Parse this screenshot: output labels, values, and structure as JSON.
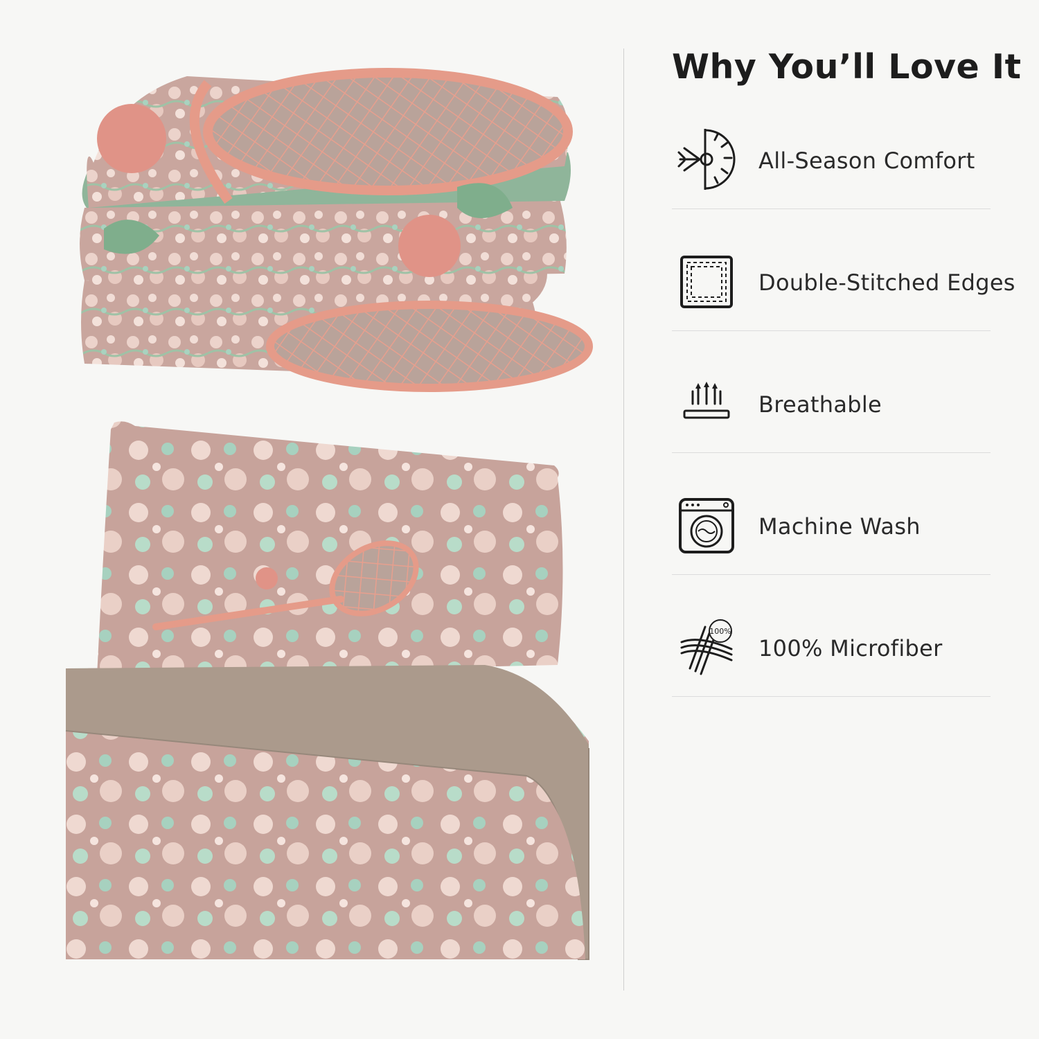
{
  "heading": "Why You’ll Love It",
  "features": [
    {
      "label": "All-Season Comfort",
      "icon": "sun-snowflake-icon"
    },
    {
      "label": "Double-Stitched Edges",
      "icon": "stitched-square-icon"
    },
    {
      "label": "Breathable",
      "icon": "breathable-arrows-icon"
    },
    {
      "label": "Machine Wash",
      "icon": "washing-machine-icon"
    },
    {
      "label": "100% Microfiber",
      "icon": "microfiber-fabric-icon"
    }
  ],
  "icon_badge_text": "100%",
  "colors": {
    "background": "#f7f7f5",
    "fabric_pink": "#d9a9a0",
    "fabric_green": "#8fb59a",
    "flat_sheet_taupe": "#ab9a8c",
    "text": "#222222"
  }
}
